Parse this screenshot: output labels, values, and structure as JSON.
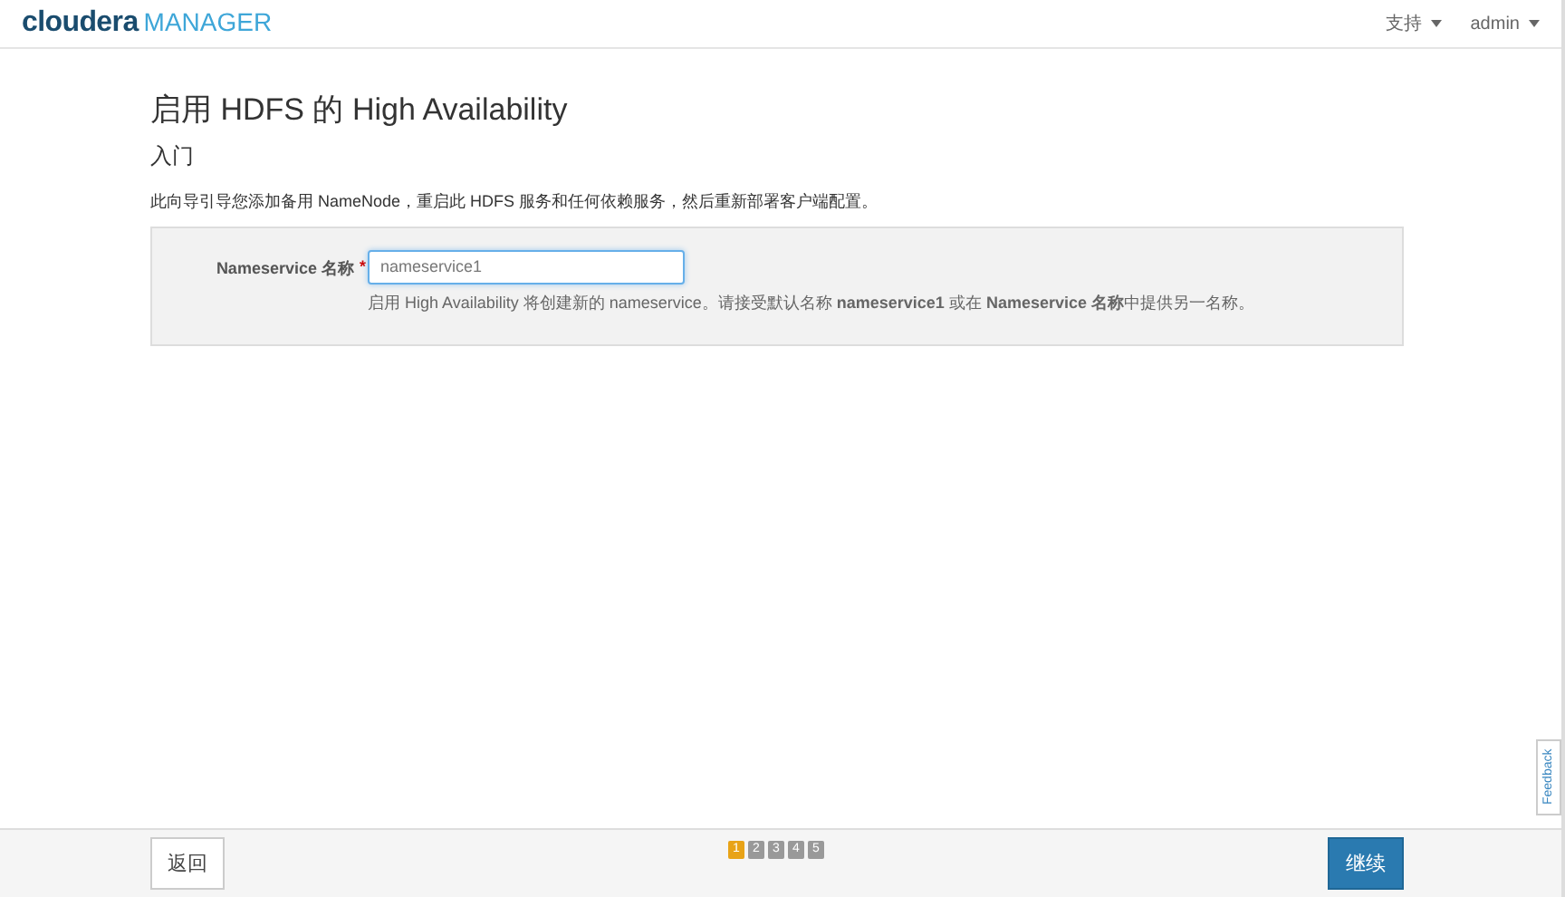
{
  "header": {
    "logo_brand": "cloudera",
    "logo_product": "MANAGER",
    "menus": [
      {
        "label": "支持"
      },
      {
        "label": "admin"
      }
    ]
  },
  "page": {
    "title": "启用 HDFS 的 High Availability",
    "subtitle": "入门",
    "intro": "此向导引导您添加备用 NameNode，重启此 HDFS 服务和任何依赖服务，然后重新部署客户端配置。",
    "field": {
      "label": "Nameservice 名称",
      "required_mark": "*",
      "value": "nameservice1",
      "help": "启用 High Availability 将创建新的 nameservice。请接受默认名称 **nameservice1** 或在 **Nameservice 名称**中提供另一名称。"
    }
  },
  "footer": {
    "back": "返回",
    "continue": "继续",
    "steps": [
      {
        "label": "1",
        "selected": true
      },
      {
        "label": "2",
        "selected": false
      },
      {
        "label": "3",
        "selected": false
      },
      {
        "label": "4",
        "selected": false
      },
      {
        "label": "5",
        "selected": false
      }
    ]
  },
  "feedback": "Feedback"
}
